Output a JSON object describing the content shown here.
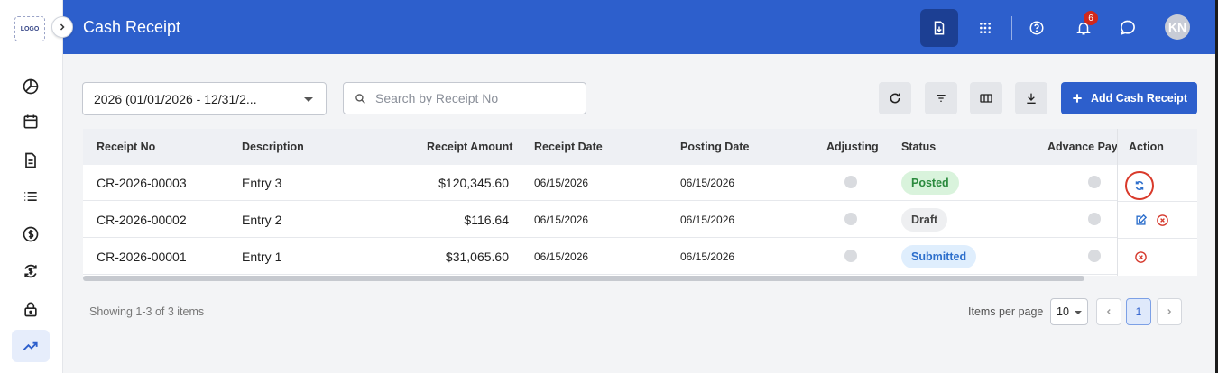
{
  "app": {
    "logo_text": "LOGO",
    "page_title": "Cash Receipt",
    "accent_color": "#2d5fcc"
  },
  "sidebar": {
    "items": [
      {
        "icon": "pie-chart-icon"
      },
      {
        "icon": "calendar-icon"
      },
      {
        "icon": "document-icon"
      },
      {
        "icon": "list-icon"
      },
      {
        "icon": "dollar-circle-icon"
      },
      {
        "icon": "currency-exchange-icon"
      },
      {
        "icon": "lock-icon"
      },
      {
        "icon": "trending-up-icon",
        "active": true
      }
    ]
  },
  "header": {
    "notification_count": "6",
    "avatar_initials": "KN",
    "icons": [
      "download-document-icon",
      "apps-grid-icon",
      "help-icon",
      "bell-icon",
      "chat-icon"
    ]
  },
  "toolbar": {
    "year_select_value": "2026 (01/01/2026 - 12/31/2...",
    "search_placeholder": "Search by Receipt No",
    "add_button_label": "Add Cash Receipt"
  },
  "table": {
    "columns": [
      "Receipt No",
      "Description",
      "Receipt Amount",
      "Receipt Date",
      "Posting Date",
      "Adjusting",
      "Status",
      "Advance Payı",
      "Action"
    ],
    "rows": [
      {
        "receipt_no": "CR-2026-00003",
        "description": "Entry 3",
        "amount": "$120,345.60",
        "receipt_date": "06/15/2026",
        "posting_date": "06/15/2026",
        "status": "Posted",
        "status_color": "#2b8a3e",
        "actions": [
          "sync-icon"
        ]
      },
      {
        "receipt_no": "CR-2026-00002",
        "description": "Entry 2",
        "amount": "$116.64",
        "receipt_date": "06/15/2026",
        "posting_date": "06/15/2026",
        "status": "Draft",
        "status_color": "#444444",
        "actions": [
          "edit-icon",
          "cancel-icon"
        ]
      },
      {
        "receipt_no": "CR-2026-00001",
        "description": "Entry 1",
        "amount": "$31,065.60",
        "receipt_date": "06/15/2026",
        "posting_date": "06/15/2026",
        "status": "Submitted",
        "status_color": "#2d6fcc",
        "actions": [
          "cancel-icon"
        ]
      }
    ]
  },
  "footer": {
    "showing_text": "Showing 1-3 of 3 items",
    "items_per_page_label": "Items per page",
    "items_per_page_value": "10",
    "current_page": "1"
  }
}
